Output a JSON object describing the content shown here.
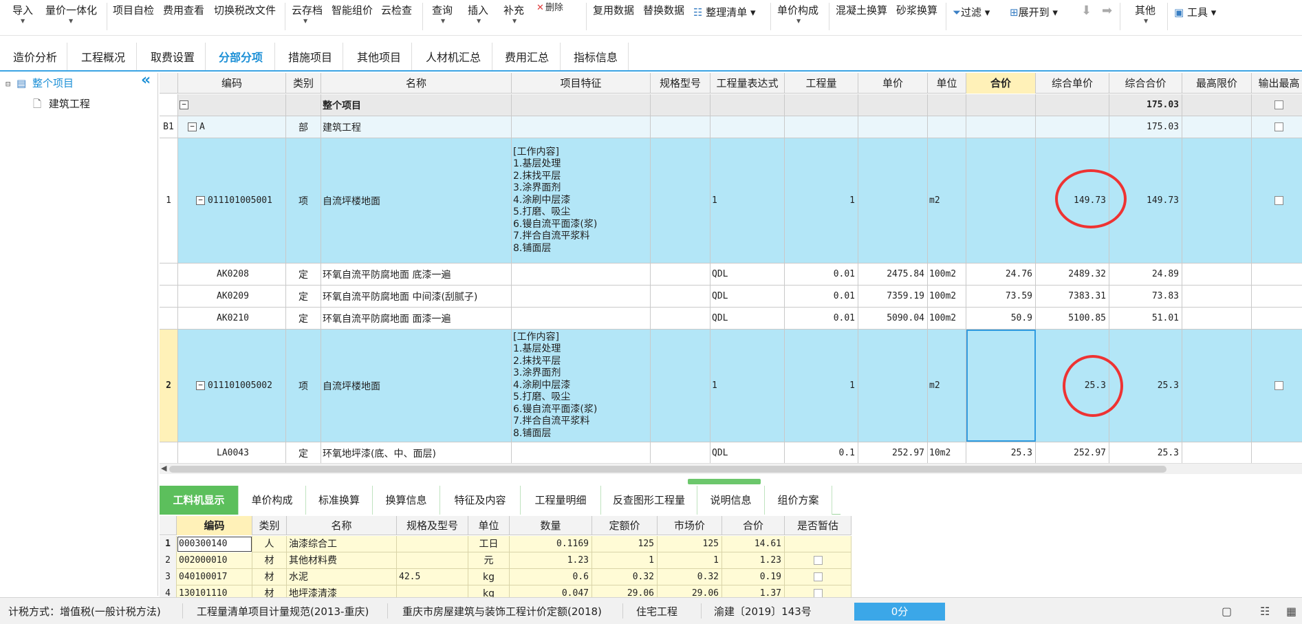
{
  "toolbar": {
    "buttons": [
      "导入",
      "量价一体化",
      "项目自检",
      "费用查看",
      "切换税改文件",
      "云存档",
      "智能组价",
      "云检查",
      "查询",
      "插入",
      "补充",
      "删除",
      "复用数据",
      "替换数据",
      "整理清单",
      "单价构成",
      "混凝土换算",
      "砂浆换算",
      "过滤",
      "展开到",
      "其他",
      "工具"
    ]
  },
  "main_tabs": [
    "造价分析",
    "工程概况",
    "取费设置",
    "分部分项",
    "措施项目",
    "其他项目",
    "人材机汇总",
    "费用汇总",
    "指标信息"
  ],
  "active_main_tab": "分部分项",
  "tree": {
    "root": "整个项目",
    "child": "建筑工程"
  },
  "grid": {
    "headers": [
      "编码",
      "类别",
      "名称",
      "项目特征",
      "规格型号",
      "工程量表达式",
      "工程量",
      "单价",
      "单位",
      "合价",
      "综合单价",
      "综合合价",
      "最高限价",
      "输出最高"
    ],
    "rows": [
      {
        "num": "",
        "code": "",
        "type": "",
        "name": "整个项目",
        "feature": "",
        "expr": "",
        "qty": "",
        "price": "",
        "unit": "",
        "total": "",
        "cprice": "",
        "ctotal": "175.03"
      },
      {
        "num": "B1",
        "code": "A",
        "type": "部",
        "name": "建筑工程",
        "feature": "",
        "expr": "",
        "qty": "",
        "price": "",
        "unit": "",
        "total": "",
        "cprice": "",
        "ctotal": "175.03"
      },
      {
        "num": "1",
        "code": "011101005001",
        "type": "项",
        "name": "自流坪楼地面",
        "feature": "[工作内容]\n1.基层处理\n2.抹找平层\n3.涂界面剂\n4.涂刷中层漆\n5.打磨、吸尘\n6.镘自流平面漆(浆)\n7.拌合自流平浆料\n8.铺面层",
        "expr": "1",
        "qty": "1",
        "price": "",
        "unit": "m2",
        "total": "",
        "cprice": "149.73",
        "ctotal": "149.73"
      },
      {
        "num": "",
        "code": "AK0208",
        "type": "定",
        "name": "环氧自流平防腐地面 底漆一遍",
        "feature": "",
        "expr": "QDL",
        "qty": "0.01",
        "price": "2475.84",
        "unit": "100m2",
        "total": "24.76",
        "cprice": "2489.32",
        "ctotal": "24.89"
      },
      {
        "num": "",
        "code": "AK0209",
        "type": "定",
        "name": "环氧自流平防腐地面 中间漆(刮腻子)",
        "feature": "",
        "expr": "QDL",
        "qty": "0.01",
        "price": "7359.19",
        "unit": "100m2",
        "total": "73.59",
        "cprice": "7383.31",
        "ctotal": "73.83"
      },
      {
        "num": "",
        "code": "AK0210",
        "type": "定",
        "name": "环氧自流平防腐地面 面漆一遍",
        "feature": "",
        "expr": "QDL",
        "qty": "0.01",
        "price": "5090.04",
        "unit": "100m2",
        "total": "50.9",
        "cprice": "5100.85",
        "ctotal": "51.01"
      },
      {
        "num": "2",
        "code": "011101005002",
        "type": "项",
        "name": "自流坪楼地面",
        "feature": "[工作内容]\n1.基层处理\n2.抹找平层\n3.涂界面剂\n4.涂刷中层漆\n5.打磨、吸尘\n6.镘自流平面漆(浆)\n7.拌合自流平浆料\n8.铺面层",
        "expr": "1",
        "qty": "1",
        "price": "",
        "unit": "m2",
        "total": "",
        "cprice": "25.3",
        "ctotal": "25.3"
      },
      {
        "num": "",
        "code": "LA0043",
        "type": "定",
        "name": "环氧地坪漆(底、中、面层)",
        "feature": "",
        "expr": "QDL",
        "qty": "0.1",
        "price": "252.97",
        "unit": "10m2",
        "total": "25.3",
        "cprice": "252.97",
        "ctotal": "25.3"
      }
    ]
  },
  "bottom_tabs": [
    "工料机显示",
    "单价构成",
    "标准换算",
    "换算信息",
    "特征及内容",
    "工程量明细",
    "反查图形工程量",
    "说明信息",
    "组价方案"
  ],
  "active_bottom_tab": "工料机显示",
  "bottom_grid": {
    "headers": [
      "",
      "编码",
      "类别",
      "名称",
      "规格及型号",
      "单位",
      "数量",
      "定额价",
      "市场价",
      "合价",
      "是否暂估"
    ],
    "rows": [
      {
        "num": "1",
        "code": "000300140",
        "type": "人",
        "name": "油漆综合工",
        "spec": "",
        "unit": "工日",
        "qty": "0.1169",
        "dprice": "125",
        "mprice": "125",
        "total": "14.61"
      },
      {
        "num": "2",
        "code": "002000010",
        "type": "材",
        "name": "其他材料费",
        "spec": "",
        "unit": "元",
        "qty": "1.23",
        "dprice": "1",
        "mprice": "1",
        "total": "1.23"
      },
      {
        "num": "3",
        "code": "040100017",
        "type": "材",
        "name": "水泥",
        "spec": "42.5",
        "unit": "kg",
        "qty": "0.6",
        "dprice": "0.32",
        "mprice": "0.32",
        "total": "0.19"
      },
      {
        "num": "4",
        "code": "130101110",
        "type": "材",
        "name": "地坪漆清漆",
        "spec": "",
        "unit": "kg",
        "qty": "0.047",
        "dprice": "29.06",
        "mprice": "29.06",
        "total": "1.37"
      }
    ]
  },
  "status": {
    "tax": "计税方式：增值税(一般计税方法)",
    "spec": "工程量清单项目计量规范(2013-重庆)",
    "quota": "重庆市房屋建筑与装饰工程计价定额(2018)",
    "type": "住宅工程",
    "doc": "渝建〔2019〕143号",
    "score": "0分"
  }
}
